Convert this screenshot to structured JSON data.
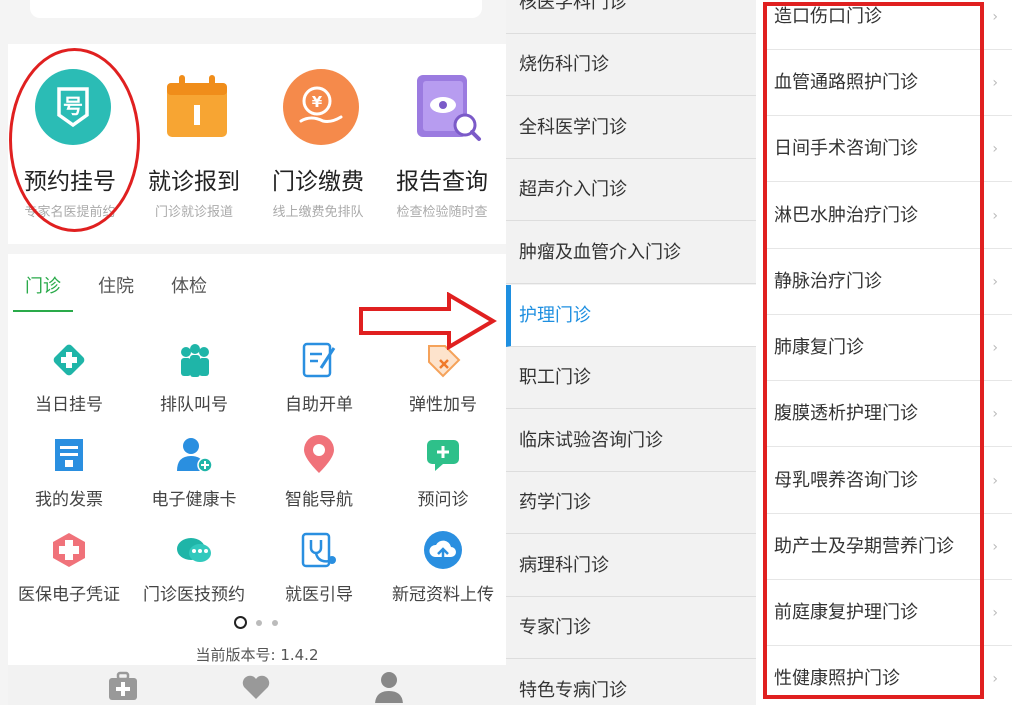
{
  "quick_actions": [
    {
      "label": "预约挂号",
      "sub": "专家名医提前约",
      "icon": "registration-icon",
      "color": "#2bbcb5"
    },
    {
      "label": "就诊报到",
      "sub": "门诊就诊报道",
      "icon": "calendar-icon",
      "color": "#f7a533"
    },
    {
      "label": "门诊缴费",
      "sub": "线上缴费免排队",
      "icon": "payment-icon",
      "color": "#f58a4b"
    },
    {
      "label": "报告查询",
      "sub": "检查检验随时查",
      "icon": "report-icon",
      "color": "#9b7be0"
    }
  ],
  "tabs": [
    {
      "label": "门诊",
      "active": true
    },
    {
      "label": "住院",
      "active": false
    },
    {
      "label": "体检",
      "active": false
    }
  ],
  "services": [
    {
      "label": "当日挂号",
      "icon": "plus-diamond-icon"
    },
    {
      "label": "排队叫号",
      "icon": "queue-people-icon"
    },
    {
      "label": "自助开单",
      "icon": "edit-form-icon"
    },
    {
      "label": "弹性加号",
      "icon": "tag-x-icon"
    },
    {
      "label": "我的发票",
      "icon": "invoice-icon"
    },
    {
      "label": "电子健康卡",
      "icon": "health-card-user-icon"
    },
    {
      "label": "智能导航",
      "icon": "location-pin-icon"
    },
    {
      "label": "预问诊",
      "icon": "chat-plus-icon"
    },
    {
      "label": "医保电子凭证",
      "icon": "insurance-cross-icon"
    },
    {
      "label": "门诊医技预约",
      "icon": "chat-bubbles-icon"
    },
    {
      "label": "就医引导",
      "icon": "stethoscope-guide-icon"
    },
    {
      "label": "新冠资料上传",
      "icon": "cloud-upload-icon"
    }
  ],
  "version_text": "当前版本号: 1.4.2",
  "departments": [
    {
      "label": "核医学科门诊",
      "active": false
    },
    {
      "label": "烧伤科门诊",
      "active": false
    },
    {
      "label": "全科医学门诊",
      "active": false
    },
    {
      "label": "超声介入门诊",
      "active": false
    },
    {
      "label": "肿瘤及血管介入门诊",
      "active": false
    },
    {
      "label": "护理门诊",
      "active": true
    },
    {
      "label": "职工门诊",
      "active": false
    },
    {
      "label": "临床试验咨询门诊",
      "active": false
    },
    {
      "label": "药学门诊",
      "active": false
    },
    {
      "label": "病理科门诊",
      "active": false
    },
    {
      "label": "专家门诊",
      "active": false
    },
    {
      "label": "特色专病门诊",
      "active": false
    }
  ],
  "clinics": [
    {
      "label": "造口伤口门诊"
    },
    {
      "label": "血管通路照护门诊"
    },
    {
      "label": "日间手术咨询门诊"
    },
    {
      "label": "淋巴水肿治疗门诊"
    },
    {
      "label": "静脉治疗门诊"
    },
    {
      "label": "肺康复门诊"
    },
    {
      "label": "腹膜透析护理门诊"
    },
    {
      "label": "母乳喂养咨询门诊"
    },
    {
      "label": "助产士及孕期营养门诊"
    },
    {
      "label": "前庭康复护理门诊"
    },
    {
      "label": "性健康照护门诊"
    }
  ],
  "clinic_arrow_glyph": "›",
  "bottom_nav": [
    {
      "icon": "medical-kit-icon"
    },
    {
      "icon": "heart-hand-icon"
    },
    {
      "icon": "user-profile-icon"
    }
  ],
  "colors": {
    "active_tab": "#2aaa4a",
    "active_department": "#1e8fe0",
    "annotation_red": "#e02020",
    "service_teal": "#1fb5a8",
    "service_blue": "#2a8fe0"
  }
}
